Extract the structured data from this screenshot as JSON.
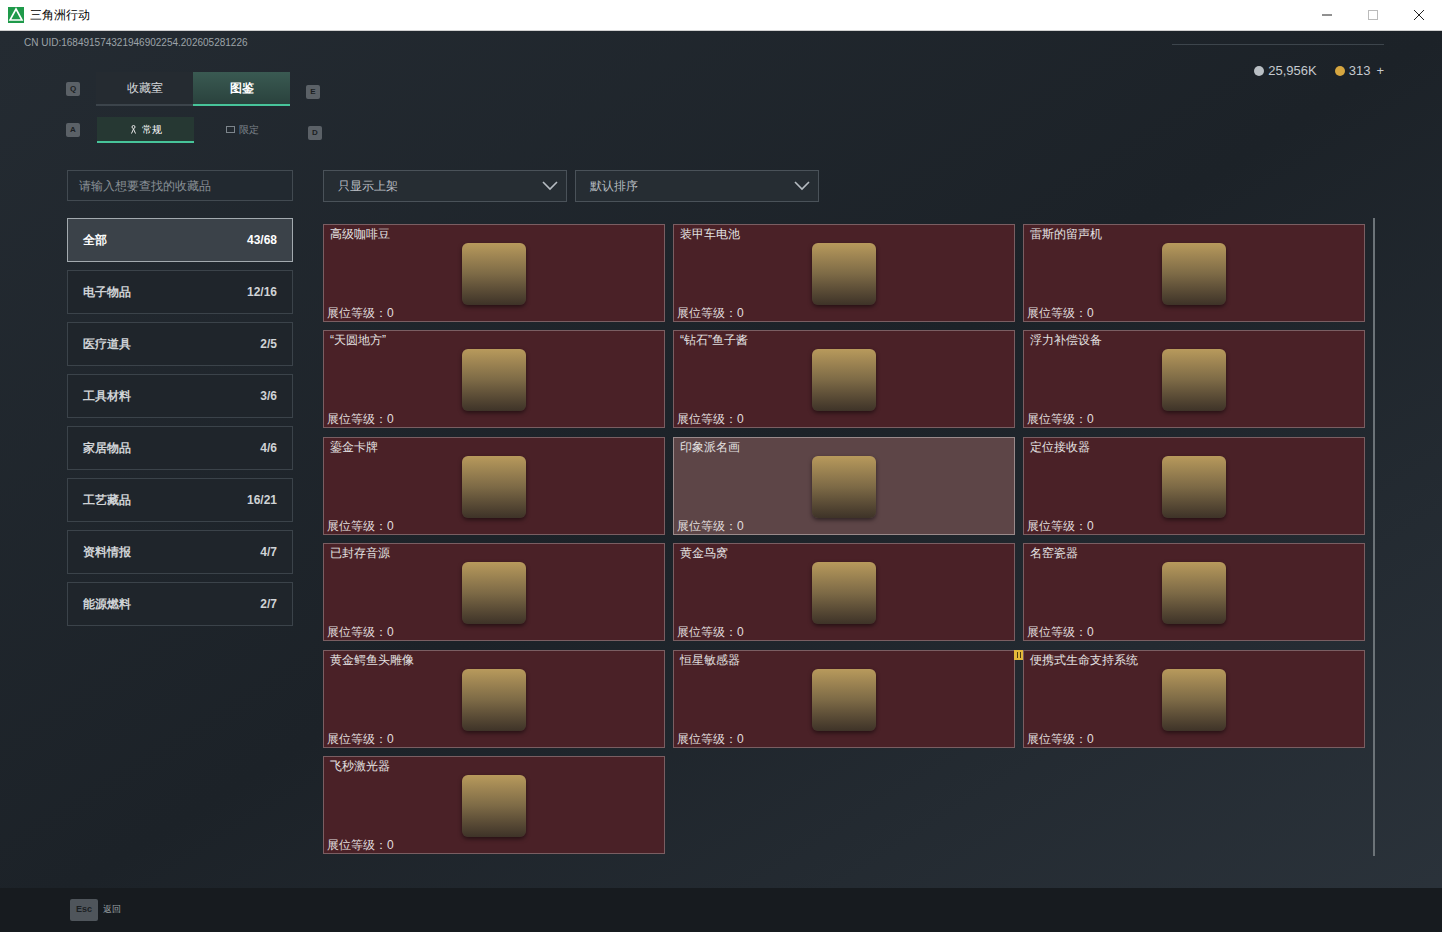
{
  "window": {
    "title": "三角洲行动"
  },
  "uid": "CN UID:168491574321946902254.202605281226",
  "currency": [
    {
      "amount": "25,956K"
    },
    {
      "amount": "313"
    }
  ],
  "add_button": "+",
  "tabs": {
    "prev_key": "Q",
    "next_key": "E",
    "items": [
      {
        "label": "收藏室",
        "selected": false
      },
      {
        "label": "图鉴",
        "selected": true
      }
    ]
  },
  "subtabs": {
    "prev_key": "A",
    "next_key": "D",
    "items": [
      {
        "label": "常规",
        "selected": true
      },
      {
        "label": "限定",
        "selected": false
      }
    ]
  },
  "search": {
    "placeholder": "请输入想要查找的收藏品"
  },
  "filters": [
    {
      "value": "只显示上架"
    },
    {
      "value": "默认排序"
    }
  ],
  "categories": [
    {
      "label": "全部",
      "count": "43/68",
      "selected": true
    },
    {
      "label": "电子物品",
      "count": "12/16",
      "selected": false
    },
    {
      "label": "医疗道具",
      "count": "2/5",
      "selected": false
    },
    {
      "label": "工具材料",
      "count": "3/6",
      "selected": false
    },
    {
      "label": "家居物品",
      "count": "4/6",
      "selected": false
    },
    {
      "label": "工艺藏品",
      "count": "16/21",
      "selected": false
    },
    {
      "label": "资料情报",
      "count": "4/7",
      "selected": false
    },
    {
      "label": "能源燃料",
      "count": "2/7",
      "selected": false
    }
  ],
  "items": [
    {
      "name": "高级咖啡豆",
      "booth_level": "展位等级：0",
      "hovered": false,
      "marked": false
    },
    {
      "name": "装甲车电池",
      "booth_level": "展位等级：0",
      "hovered": false,
      "marked": false
    },
    {
      "name": "雷斯的留声机",
      "booth_level": "展位等级：0",
      "hovered": false,
      "marked": false
    },
    {
      "name": "“天圆地方”",
      "booth_level": "展位等级：0",
      "hovered": false,
      "marked": false
    },
    {
      "name": "“钻石”鱼子酱",
      "booth_level": "展位等级：0",
      "hovered": false,
      "marked": false
    },
    {
      "name": "浮力补偿设备",
      "booth_level": "展位等级：0",
      "hovered": false,
      "marked": false
    },
    {
      "name": "鎏金卡牌",
      "booth_level": "展位等级：0",
      "hovered": false,
      "marked": false
    },
    {
      "name": "印象派名画",
      "booth_level": "展位等级：0",
      "hovered": true,
      "marked": false
    },
    {
      "name": "定位接收器",
      "booth_level": "展位等级：0",
      "hovered": false,
      "marked": false
    },
    {
      "name": "已封存音源",
      "booth_level": "展位等级：0",
      "hovered": false,
      "marked": false
    },
    {
      "name": "黄金鸟窝",
      "booth_level": "展位等级：0",
      "hovered": false,
      "marked": false
    },
    {
      "name": "名窑瓷器",
      "booth_level": "展位等级：0",
      "hovered": false,
      "marked": false
    },
    {
      "name": "黄金鳄鱼头雕像",
      "booth_level": "展位等级：0",
      "hovered": false,
      "marked": false
    },
    {
      "name": "恒星敏感器",
      "booth_level": "展位等级：0",
      "hovered": false,
      "marked": true
    },
    {
      "name": "便携式生命支持系统",
      "booth_level": "展位等级：0",
      "hovered": false,
      "marked": false
    },
    {
      "name": "飞秒激光器",
      "booth_level": "展位等级：0",
      "hovered": false,
      "marked": false
    }
  ],
  "footer": {
    "key": "Esc",
    "label": "返回"
  }
}
